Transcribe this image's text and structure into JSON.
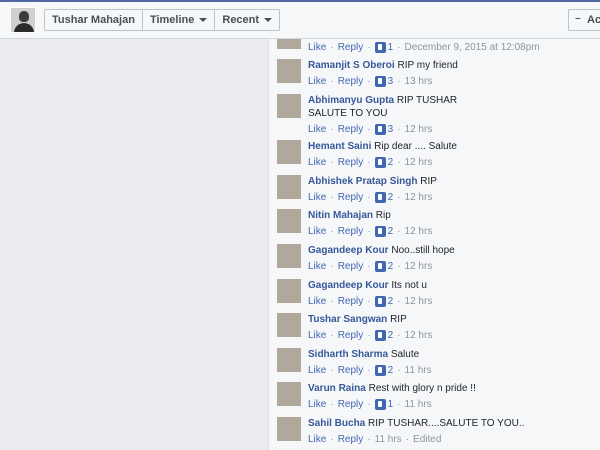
{
  "header": {
    "name": "Tushar Mahajan",
    "timeline": "Timeline",
    "recent": "Recent",
    "add_button": "Ac"
  },
  "comments": [
    {
      "author": "",
      "text": "",
      "like": "Like",
      "reply": "Reply",
      "likes": "1",
      "time": "December 9, 2015 at 12:08pm",
      "edited": ""
    },
    {
      "author": "Ramanjit S Oberoi",
      "text": "RIP my friend",
      "like": "Like",
      "reply": "Reply",
      "likes": "3",
      "time": "13 hrs",
      "edited": ""
    },
    {
      "author": "Abhimanyu Gupta",
      "text": "RIP TUSHAR SALUTE TO YOU",
      "like": "Like",
      "reply": "Reply",
      "likes": "3",
      "time": "12 hrs",
      "edited": ""
    },
    {
      "author": "Hemant Saini",
      "text": "Rip dear .... Salute",
      "like": "Like",
      "reply": "Reply",
      "likes": "2",
      "time": "12 hrs",
      "edited": ""
    },
    {
      "author": "Abhishek Pratap Singh",
      "text": "RIP",
      "like": "Like",
      "reply": "Reply",
      "likes": "2",
      "time": "12 hrs",
      "edited": ""
    },
    {
      "author": "Nitin Mahajan",
      "text": "Rip",
      "like": "Like",
      "reply": "Reply",
      "likes": "2",
      "time": "12 hrs",
      "edited": ""
    },
    {
      "author": "Gagandeep Kour",
      "text": "Noo..still hope",
      "like": "Like",
      "reply": "Reply",
      "likes": "2",
      "time": "12 hrs",
      "edited": ""
    },
    {
      "author": "Gagandeep Kour",
      "text": "Its not u",
      "like": "Like",
      "reply": "Reply",
      "likes": "2",
      "time": "12 hrs",
      "edited": ""
    },
    {
      "author": "Tushar Sangwan",
      "text": "RIP",
      "like": "Like",
      "reply": "Reply",
      "likes": "2",
      "time": "12 hrs",
      "edited": ""
    },
    {
      "author": "Sidharth Sharma",
      "text": "Salute",
      "like": "Like",
      "reply": "Reply",
      "likes": "2",
      "time": "11 hrs",
      "edited": ""
    },
    {
      "author": "Varun Raina",
      "text": "Rest with glory n pride !!",
      "like": "Like",
      "reply": "Reply",
      "likes": "1",
      "time": "11 hrs",
      "edited": ""
    },
    {
      "author": "Sahil Bucha",
      "text": "RIP TUSHAR....SALUTE TO YOU..",
      "like": "Like",
      "reply": "Reply",
      "likes": "",
      "time": "11 hrs",
      "edited": "Edited"
    }
  ],
  "colors": {
    "link": "#365899",
    "meta": "#90949c",
    "accent": "#4267b2"
  }
}
